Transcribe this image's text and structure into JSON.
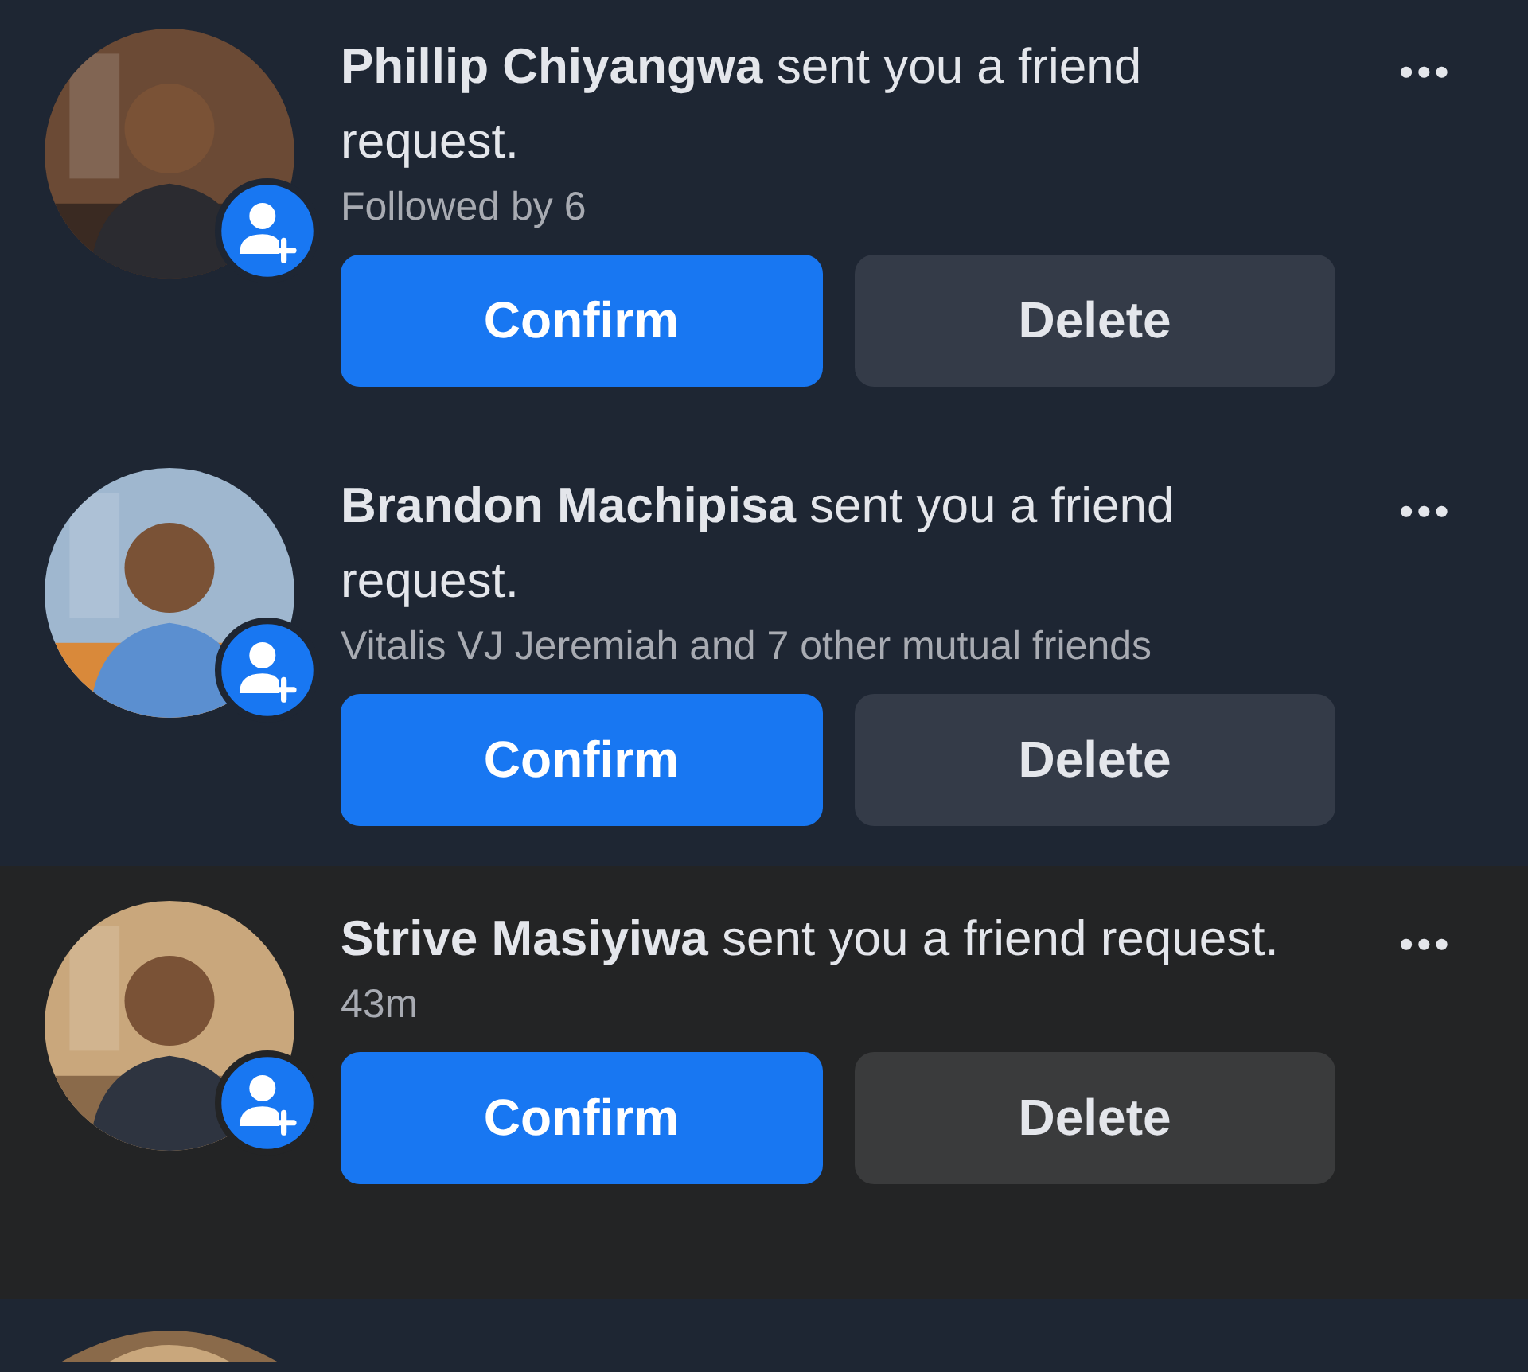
{
  "requests": [
    {
      "text": "**Phillip Chiyangwa** sent you a friend request.",
      "detail": "Followed by 6",
      "unread": true,
      "confirm": "Confirm",
      "delete": "Delete",
      "more": "•••"
    },
    {
      "text": "**Brandon Machipisa** sent you a friend request.",
      "detail": "Vitalis VJ Jeremiah and 7 other mutual friends",
      "unread": true,
      "confirm": "Confirm",
      "delete": "Delete",
      "more": "•••"
    },
    {
      "text": "**Strive Masiyiwa** sent you a friend request.",
      "detail": "43m",
      "unread": false,
      "confirm": "Confirm",
      "delete": "Delete",
      "more": "•••"
    }
  ]
}
